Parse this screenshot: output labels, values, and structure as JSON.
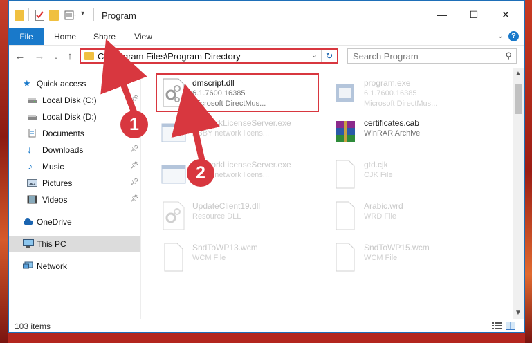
{
  "window": {
    "title": "Program",
    "controls": {
      "minimize": "—",
      "maximize": "☐",
      "close": "✕"
    }
  },
  "ribbon": {
    "tabs": [
      "File",
      "Home",
      "Share",
      "View"
    ],
    "help": "?"
  },
  "address_bar": {
    "path": "C:\\Program Files\\Program Directory",
    "search_placeholder": "Search Program"
  },
  "sidebar": {
    "items": [
      {
        "label": "Quick access",
        "icon": "star-icon"
      },
      {
        "label": "Local Disk (C:)",
        "icon": "drive-icon",
        "pinned": true
      },
      {
        "label": "Local Disk (D:)",
        "icon": "drive-icon"
      },
      {
        "label": "Documents",
        "icon": "documents-icon"
      },
      {
        "label": "Downloads",
        "icon": "download-icon",
        "pinned": true
      },
      {
        "label": "Music",
        "icon": "music-icon",
        "pinned": true
      },
      {
        "label": "Pictures",
        "icon": "pictures-icon",
        "pinned": true
      },
      {
        "label": "Videos",
        "icon": "videos-icon",
        "pinned": true
      },
      {
        "label": "OneDrive",
        "icon": "cloud-icon"
      },
      {
        "label": "This PC",
        "icon": "computer-icon",
        "selected": true
      },
      {
        "label": "Network",
        "icon": "network-icon"
      }
    ]
  },
  "files": [
    {
      "name": "dmscript.dll",
      "line2": "6.1.7600.16385",
      "line3": "Microsoft DirectMus...",
      "icon": "dll-gear-icon",
      "highlighted": true
    },
    {
      "name": "program.exe",
      "line2": "6.1.7600.16385",
      "line3": "Microsoft DirectMus...",
      "icon": "exe-icon"
    },
    {
      "name": "NetworkLicenseServer.exe",
      "line2": "ABBY network licens...",
      "line3": "",
      "icon": "exe-window-icon"
    },
    {
      "name": "certificates.cab",
      "line2": "WinRAR Archive",
      "line3": "",
      "icon": "winrar-icon"
    },
    {
      "name": "NetworkLicenseServer.exe",
      "line2": "ABBY network licens...",
      "line3": "",
      "icon": "exe-window-icon"
    },
    {
      "name": "gtd.cjk",
      "line2": "CJK File",
      "line3": "",
      "icon": "blank-file-icon"
    },
    {
      "name": "UpdateClient19.dll",
      "line2": "Resource DLL",
      "line3": "",
      "icon": "dll-gear-icon"
    },
    {
      "name": "Arabic.wrd",
      "line2": "WRD File",
      "line3": "",
      "icon": "blank-file-icon"
    },
    {
      "name": "SndToWP13.wcm",
      "line2": "WCM File",
      "line3": "",
      "icon": "blank-file-icon"
    },
    {
      "name": "SndToWP15.wcm",
      "line2": "WCM File",
      "line3": "",
      "icon": "blank-file-icon"
    }
  ],
  "status": {
    "count": "103 items"
  },
  "annotations": {
    "marker1": "1",
    "marker2": "2",
    "color": "#d8373f"
  }
}
